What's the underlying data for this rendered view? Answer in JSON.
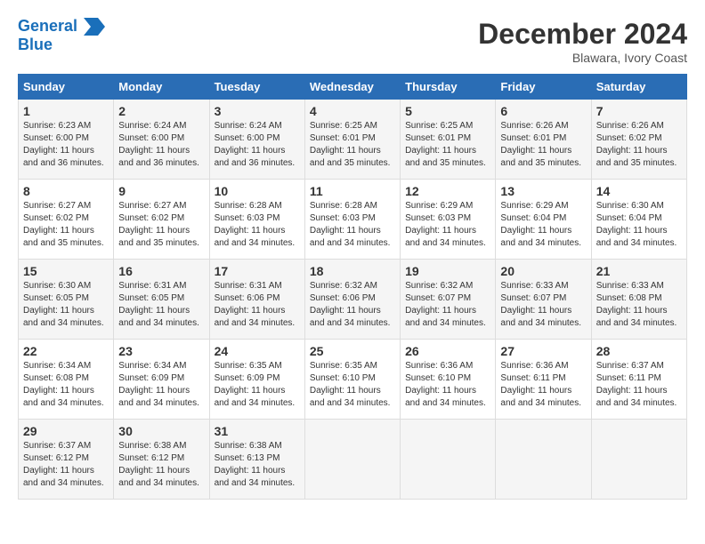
{
  "header": {
    "logo_line1": "General",
    "logo_line2": "Blue",
    "month": "December 2024",
    "location": "Blawara, Ivory Coast"
  },
  "weekdays": [
    "Sunday",
    "Monday",
    "Tuesday",
    "Wednesday",
    "Thursday",
    "Friday",
    "Saturday"
  ],
  "weeks": [
    [
      {
        "day": "1",
        "sunrise": "6:23 AM",
        "sunset": "6:00 PM",
        "daylight": "11 hours and 36 minutes."
      },
      {
        "day": "2",
        "sunrise": "6:24 AM",
        "sunset": "6:00 PM",
        "daylight": "11 hours and 36 minutes."
      },
      {
        "day": "3",
        "sunrise": "6:24 AM",
        "sunset": "6:00 PM",
        "daylight": "11 hours and 36 minutes."
      },
      {
        "day": "4",
        "sunrise": "6:25 AM",
        "sunset": "6:01 PM",
        "daylight": "11 hours and 35 minutes."
      },
      {
        "day": "5",
        "sunrise": "6:25 AM",
        "sunset": "6:01 PM",
        "daylight": "11 hours and 35 minutes."
      },
      {
        "day": "6",
        "sunrise": "6:26 AM",
        "sunset": "6:01 PM",
        "daylight": "11 hours and 35 minutes."
      },
      {
        "day": "7",
        "sunrise": "6:26 AM",
        "sunset": "6:02 PM",
        "daylight": "11 hours and 35 minutes."
      }
    ],
    [
      {
        "day": "8",
        "sunrise": "6:27 AM",
        "sunset": "6:02 PM",
        "daylight": "11 hours and 35 minutes."
      },
      {
        "day": "9",
        "sunrise": "6:27 AM",
        "sunset": "6:02 PM",
        "daylight": "11 hours and 35 minutes."
      },
      {
        "day": "10",
        "sunrise": "6:28 AM",
        "sunset": "6:03 PM",
        "daylight": "11 hours and 34 minutes."
      },
      {
        "day": "11",
        "sunrise": "6:28 AM",
        "sunset": "6:03 PM",
        "daylight": "11 hours and 34 minutes."
      },
      {
        "day": "12",
        "sunrise": "6:29 AM",
        "sunset": "6:03 PM",
        "daylight": "11 hours and 34 minutes."
      },
      {
        "day": "13",
        "sunrise": "6:29 AM",
        "sunset": "6:04 PM",
        "daylight": "11 hours and 34 minutes."
      },
      {
        "day": "14",
        "sunrise": "6:30 AM",
        "sunset": "6:04 PM",
        "daylight": "11 hours and 34 minutes."
      }
    ],
    [
      {
        "day": "15",
        "sunrise": "6:30 AM",
        "sunset": "6:05 PM",
        "daylight": "11 hours and 34 minutes."
      },
      {
        "day": "16",
        "sunrise": "6:31 AM",
        "sunset": "6:05 PM",
        "daylight": "11 hours and 34 minutes."
      },
      {
        "day": "17",
        "sunrise": "6:31 AM",
        "sunset": "6:06 PM",
        "daylight": "11 hours and 34 minutes."
      },
      {
        "day": "18",
        "sunrise": "6:32 AM",
        "sunset": "6:06 PM",
        "daylight": "11 hours and 34 minutes."
      },
      {
        "day": "19",
        "sunrise": "6:32 AM",
        "sunset": "6:07 PM",
        "daylight": "11 hours and 34 minutes."
      },
      {
        "day": "20",
        "sunrise": "6:33 AM",
        "sunset": "6:07 PM",
        "daylight": "11 hours and 34 minutes."
      },
      {
        "day": "21",
        "sunrise": "6:33 AM",
        "sunset": "6:08 PM",
        "daylight": "11 hours and 34 minutes."
      }
    ],
    [
      {
        "day": "22",
        "sunrise": "6:34 AM",
        "sunset": "6:08 PM",
        "daylight": "11 hours and 34 minutes."
      },
      {
        "day": "23",
        "sunrise": "6:34 AM",
        "sunset": "6:09 PM",
        "daylight": "11 hours and 34 minutes."
      },
      {
        "day": "24",
        "sunrise": "6:35 AM",
        "sunset": "6:09 PM",
        "daylight": "11 hours and 34 minutes."
      },
      {
        "day": "25",
        "sunrise": "6:35 AM",
        "sunset": "6:10 PM",
        "daylight": "11 hours and 34 minutes."
      },
      {
        "day": "26",
        "sunrise": "6:36 AM",
        "sunset": "6:10 PM",
        "daylight": "11 hours and 34 minutes."
      },
      {
        "day": "27",
        "sunrise": "6:36 AM",
        "sunset": "6:11 PM",
        "daylight": "11 hours and 34 minutes."
      },
      {
        "day": "28",
        "sunrise": "6:37 AM",
        "sunset": "6:11 PM",
        "daylight": "11 hours and 34 minutes."
      }
    ],
    [
      {
        "day": "29",
        "sunrise": "6:37 AM",
        "sunset": "6:12 PM",
        "daylight": "11 hours and 34 minutes."
      },
      {
        "day": "30",
        "sunrise": "6:38 AM",
        "sunset": "6:12 PM",
        "daylight": "11 hours and 34 minutes."
      },
      {
        "day": "31",
        "sunrise": "6:38 AM",
        "sunset": "6:13 PM",
        "daylight": "11 hours and 34 minutes."
      },
      null,
      null,
      null,
      null
    ]
  ]
}
